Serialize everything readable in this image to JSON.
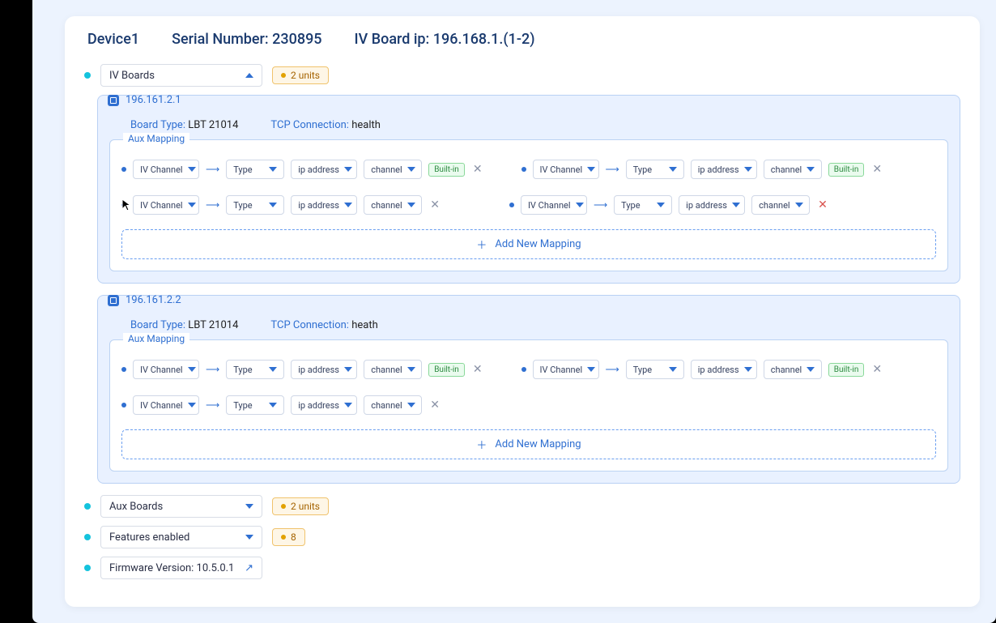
{
  "header": {
    "device": "Device1",
    "serial_label": "Serial Number:",
    "serial_value": "230895",
    "ivboard_label": "IV Board ip:",
    "ivboard_value": "196.168.1.(1-2)"
  },
  "sections": {
    "iv_boards_label": "IV Boards",
    "iv_boards_count": "2 units",
    "aux_boards_label": "Aux Boards",
    "aux_boards_count": "2 units",
    "features_label": "Features enabled",
    "features_count": "8",
    "firmware_label": "Firmware Version:",
    "firmware_value": "10.5.0.1"
  },
  "boards": [
    {
      "ip": "196.161.2.1",
      "board_type_label": "Board Type:",
      "board_type_value": "LBT 21014",
      "tcp_label": "TCP Connection:",
      "tcp_value": "health",
      "aux_label": "Aux Mapping",
      "add_label": "Add New Mapping"
    },
    {
      "ip": "196.161.2.2",
      "board_type_label": "Board Type:",
      "board_type_value": "LBT 21014",
      "tcp_label": "TCP Connection:",
      "tcp_value": "heath",
      "aux_label": "Aux Mapping",
      "add_label": "Add New Mapping"
    }
  ],
  "dd": {
    "iv": "IV Channel",
    "type": "Type",
    "ip": "ip address",
    "channel": "channel",
    "builtin": "Built-in"
  }
}
